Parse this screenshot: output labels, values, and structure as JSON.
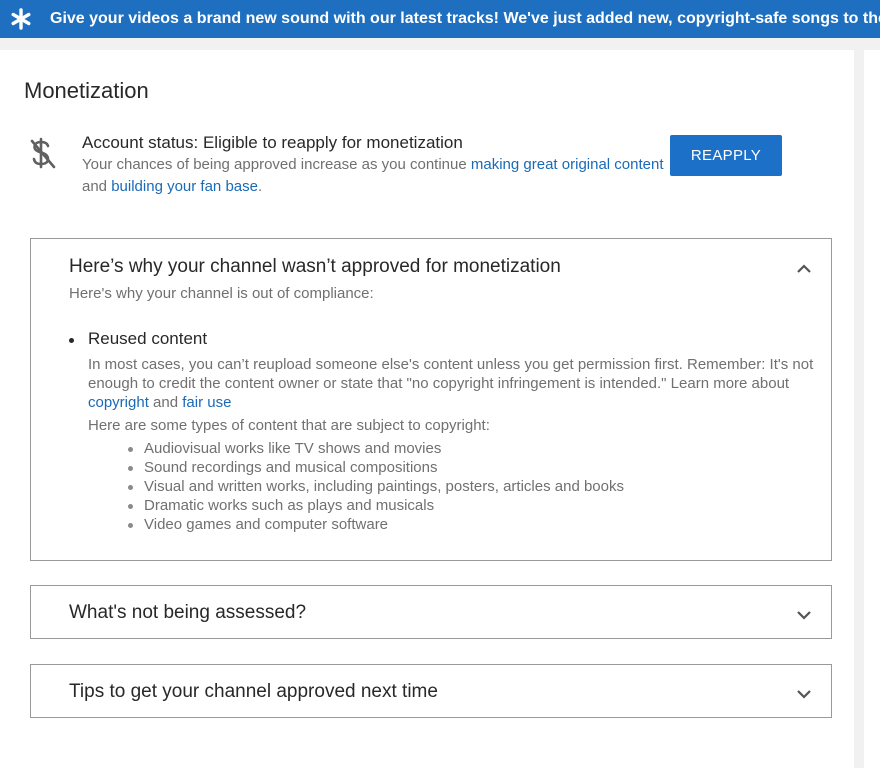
{
  "banner": {
    "icon": "star-icon",
    "text": "Give your videos a brand new sound with our latest tracks! We've just added new, copyright-safe songs to the YouTube Audio Library."
  },
  "page": {
    "title": "Monetization"
  },
  "status": {
    "icon": "no-monetization-icon",
    "title": "Account status: Eligible to reapply for monetization",
    "desc_part1": "Your chances of being approved increase as you continue ",
    "link1": "making great original content",
    "desc_part2": " and ",
    "link2": "building your fan base",
    "desc_part3": ".",
    "button_label": "REAPPLY"
  },
  "panels": [
    {
      "title": "Here’s why your channel wasn’t approved for monetization",
      "subtitle": "Here's why your channel is out of compliance:",
      "expanded": true,
      "chevron": "chevron-up-icon",
      "reason": {
        "title": "Reused content",
        "para1_part1": "In most cases, you can’t reupload someone else's content unless you get permission first. Remember: It's not enough to credit the content owner or state that \"no copyright infringement is intended.\" Learn more about ",
        "link_copyright": "copyright",
        "para1_and": " and ",
        "link_fair_use": "fair use",
        "para2": "Here are some types of content that are subject to copyright:",
        "types": [
          "Audiovisual works like TV shows and movies",
          "Sound recordings and musical compositions",
          "Visual and written works, including paintings, posters, articles and books",
          "Dramatic works such as plays and musicals",
          "Video games and computer software"
        ]
      }
    },
    {
      "title": "What's not being assessed?",
      "expanded": false,
      "chevron": "chevron-down-icon"
    },
    {
      "title": "Tips to get your channel approved next time",
      "expanded": false,
      "chevron": "chevron-down-icon"
    }
  ],
  "colors": {
    "banner_bg": "#1e6fc0",
    "button_bg": "#1c70c8",
    "link": "#1a6ab8",
    "secondary_text": "#707070",
    "page_bg": "#f1f1f1"
  }
}
